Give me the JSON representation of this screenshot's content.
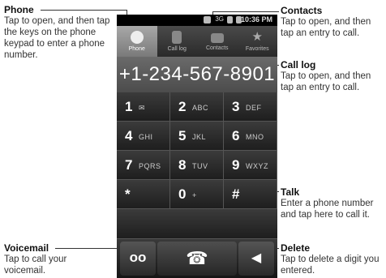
{
  "annotations": {
    "phone": {
      "title": "Phone",
      "text": "Tap to open, and then tap the keys on the phone keypad to enter a phone number."
    },
    "contacts": {
      "title": "Contacts",
      "text": "Tap to open, and then tap an entry to call."
    },
    "call_log": {
      "title": "Call log",
      "text": "Tap to open, and then tap an entry to call."
    },
    "talk": {
      "title": "Talk",
      "text": "Enter a phone number and tap here to call it."
    },
    "voicemail": {
      "title": "Voicemail",
      "text": "Tap to call your voicemail."
    },
    "delete": {
      "title": "Delete",
      "text": "Tap to delete a digit you entered."
    }
  },
  "status_bar": {
    "time": "10:36 PM",
    "network": "3G"
  },
  "tabs": [
    {
      "label": "Phone",
      "icon": "phone-icon",
      "active": true
    },
    {
      "label": "Call log",
      "icon": "call-log-icon",
      "active": false
    },
    {
      "label": "Contacts",
      "icon": "contacts-icon",
      "active": false
    },
    {
      "label": "Favorites",
      "icon": "favorites-icon",
      "active": false
    }
  ],
  "dialed_number": "+1-234-567-8901",
  "keys": [
    {
      "digit": "1",
      "letters": "✉"
    },
    {
      "digit": "2",
      "letters": "ABC"
    },
    {
      "digit": "3",
      "letters": "DEF"
    },
    {
      "digit": "4",
      "letters": "GHI"
    },
    {
      "digit": "5",
      "letters": "JKL"
    },
    {
      "digit": "6",
      "letters": "MNO"
    },
    {
      "digit": "7",
      "letters": "PQRS"
    },
    {
      "digit": "8",
      "letters": "TUV"
    },
    {
      "digit": "9",
      "letters": "WXYZ"
    },
    {
      "digit": "*",
      "letters": ""
    },
    {
      "digit": "0",
      "letters": "+"
    },
    {
      "digit": "#",
      "letters": ""
    }
  ],
  "buttons": {
    "voicemail": "oo",
    "talk": "☎",
    "delete": "◀"
  }
}
